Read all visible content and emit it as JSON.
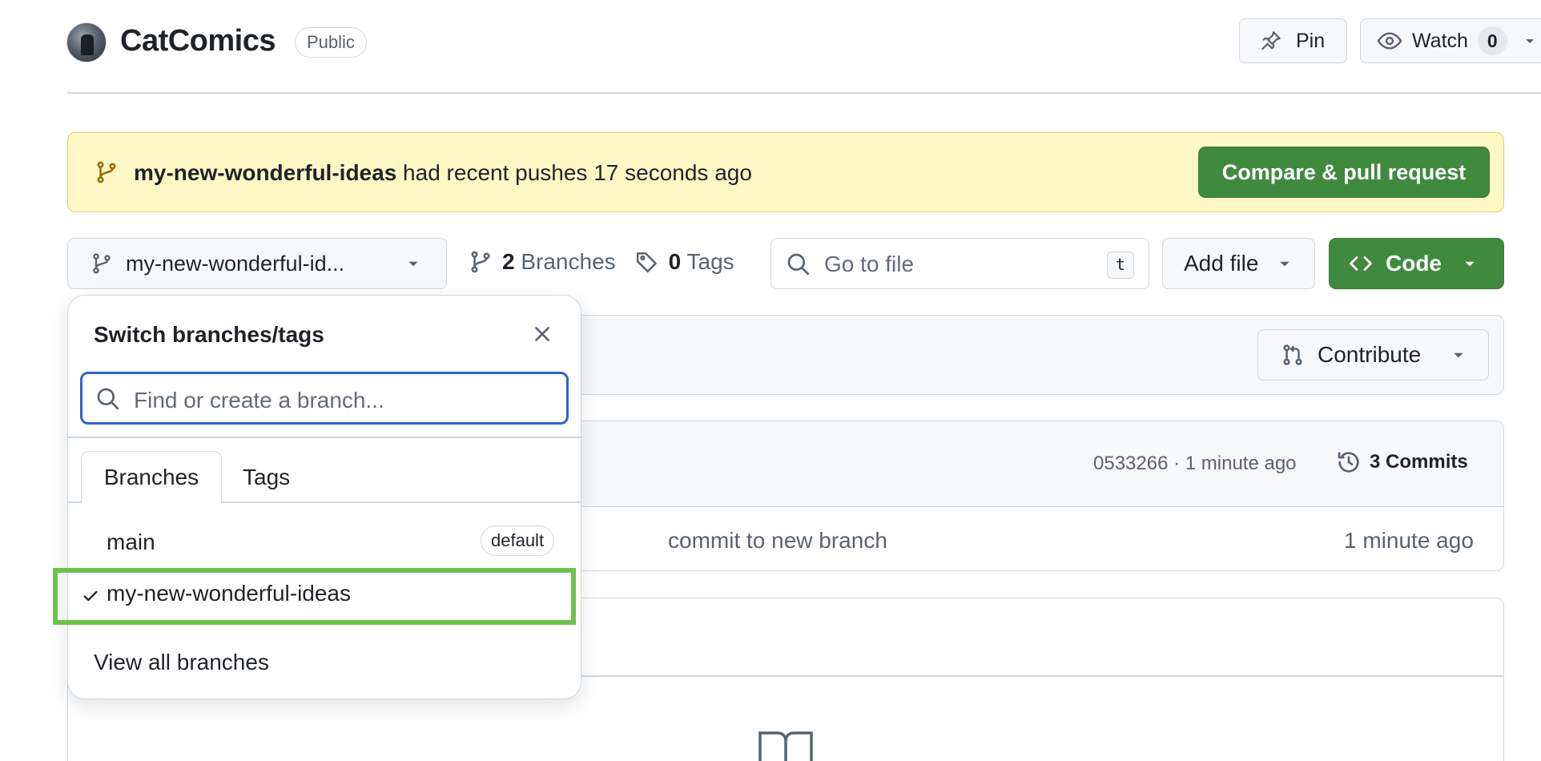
{
  "repo": {
    "name": "CatComics",
    "visibility": "Public"
  },
  "header_actions": {
    "pin_label": "Pin",
    "watch_label": "Watch",
    "watch_count": "0"
  },
  "banner": {
    "branch": "my-new-wonderful-ideas",
    "message": " had recent pushes 17 seconds ago",
    "button_label": "Compare & pull request"
  },
  "toolbar": {
    "branch_selector_label": "my-new-wonderful-id...",
    "branches_count": "2",
    "branches_label": "Branches",
    "tags_count": "0",
    "tags_label": "Tags",
    "goto_placeholder": "Go to file",
    "goto_shortcut": "t",
    "add_file_label": "Add file",
    "code_label": "Code"
  },
  "contribute_label": "Contribute",
  "latest_commit": {
    "meta": "0533266 · 1 minute ago",
    "commits_label": "3 Commits"
  },
  "file_row": {
    "message": "commit to new branch",
    "time": "1 minute ago"
  },
  "dropdown": {
    "title": "Switch branches/tags",
    "search_placeholder": "Find or create a branch...",
    "tabs": [
      "Branches",
      "Tags"
    ],
    "active_tab": "Branches",
    "branches": [
      {
        "name": "main",
        "badge": "default",
        "selected": false
      },
      {
        "name": "my-new-wonderful-ideas",
        "badge": "",
        "selected": true
      }
    ],
    "view_all_label": "View all branches"
  },
  "colors": {
    "primary_green": "#3f8a3f",
    "banner_bg": "#fff8c5",
    "focus_blue": "#2f64c5",
    "highlight_green": "#6cc24a"
  },
  "icons": [
    "branch-icon",
    "pin-icon",
    "eye-icon",
    "tag-icon",
    "search-icon",
    "code-icon",
    "pull-request-icon",
    "history-icon",
    "close-icon",
    "check-icon",
    "book-icon",
    "caret-down-icon"
  ]
}
